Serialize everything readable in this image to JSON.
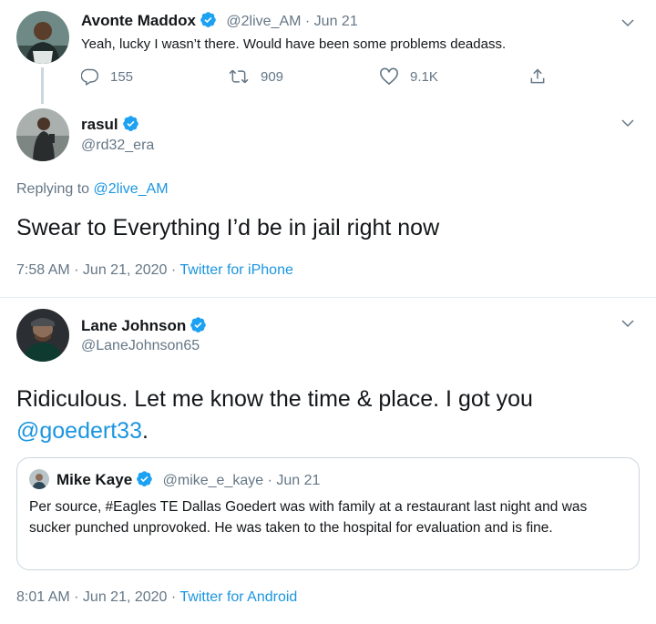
{
  "tweet1": {
    "name": "Avonte Maddox",
    "handle": "@2live_AM",
    "sep": "·",
    "date": "Jun 21",
    "text": "Yeah, lucky I wasn’t there. Would have been some problems deadass.",
    "replies": "155",
    "retweets": "909",
    "likes": "9.1K"
  },
  "tweet2": {
    "name": "rasul",
    "handle": "@rd32_era",
    "replying_prefix": "Replying to ",
    "replying_to": "@2live_AM",
    "text": "Swear to Everything I’d be in jail right now",
    "timestamp": "7:58 AM · Jun 21, 2020 · ",
    "source": "Twitter for iPhone"
  },
  "tweet3": {
    "name": "Lane Johnson",
    "handle": "@LaneJohnson65",
    "text_line1": "Ridiculous. Let me know the time & place. I got you",
    "mention": "@goedert33",
    "text_end": ".",
    "timestamp": "8:01 AM · Jun 21, 2020 · ",
    "source": "Twitter for Android"
  },
  "quote": {
    "name": "Mike Kaye",
    "handle": "@mike_e_kaye",
    "sep": "·",
    "date": "Jun 21",
    "text": "Per source, #Eagles TE Dallas Goedert was with family at a restaurant last night and was sucker punched unprovoked. He was taken to the hospital for evaluation and is fine."
  },
  "colors": {
    "link": "#1b95e0",
    "muted": "#657786",
    "verified": "#1da1f2"
  },
  "icons": [
    "verified-badge-icon",
    "chevron-down-icon",
    "reply-icon",
    "retweet-icon",
    "like-icon",
    "share-icon"
  ]
}
